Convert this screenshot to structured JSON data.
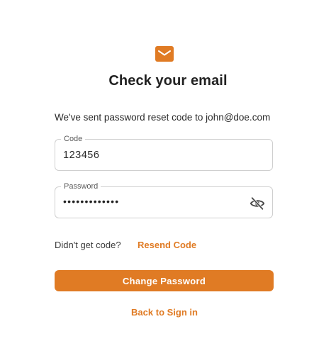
{
  "header": {
    "icon": "mail-icon",
    "title": "Check your email",
    "subtitle": "We've sent password reset code to john@doe.com"
  },
  "form": {
    "code": {
      "label": "Code",
      "value": "123456"
    },
    "password": {
      "label": "Password",
      "masked_value": "•••••••••••••",
      "toggle_icon": "eye-off-icon"
    }
  },
  "resend": {
    "prompt": "Didn't get code?",
    "link": "Resend Code"
  },
  "actions": {
    "submit_label": "Change Password",
    "back_label": "Back to Sign in"
  },
  "colors": {
    "accent": "#e07b24",
    "border": "#cfcfcf",
    "text": "#2a2a2a"
  }
}
